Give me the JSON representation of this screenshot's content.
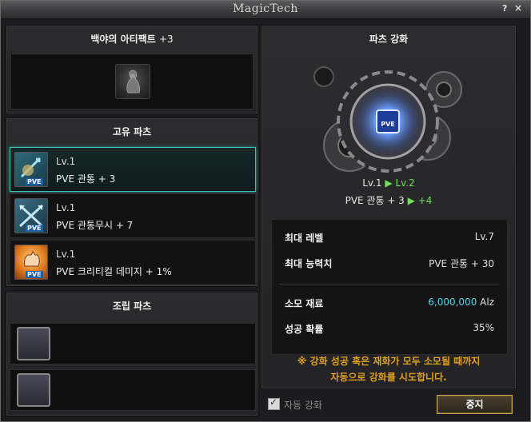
{
  "window": {
    "title": "MagicTech",
    "help_label": "?",
    "close_label": "×"
  },
  "artifact_panel": {
    "title": "백야의 아티팩트",
    "title_suffix": "+3"
  },
  "unique_parts": {
    "title": "고유 파츠",
    "items": [
      {
        "level": "Lv.1",
        "stat": "PVE 관통  +  3",
        "icon": "pve-piercing-icon",
        "badge": "PVE"
      },
      {
        "level": "Lv.1",
        "stat": "PVE 관통무시  +  7",
        "icon": "pve-piercing-ignore-icon",
        "badge": "PVE"
      },
      {
        "level": "Lv.1",
        "stat": "PVE 크리티컬 데미지  +  1%",
        "icon": "pve-critical-damage-icon",
        "badge": "PVE"
      }
    ]
  },
  "assembly_parts": {
    "title": "조립 파츠"
  },
  "enhance_panel": {
    "title": "파츠 강화",
    "level_from": "Lv.1",
    "level_to": "Lv.2",
    "stat_label": "PVE 관통  +  3",
    "stat_increase": "+4",
    "arrow": "▶",
    "info": {
      "max_level_label": "최대 레벨",
      "max_level_value": "Lv.7",
      "max_ability_label": "최대 능력치",
      "max_ability_value": "PVE 관통  + 30",
      "material_label": "소모 재료",
      "material_value": "6,000,000",
      "material_unit": "Alz",
      "success_label": "성공 확률",
      "success_value": "35%"
    },
    "notice_line1": "※ 강화 성공 혹은 재화가 모두 소모될 때까지",
    "notice_line2": "자동으로 강화를 시도합니다."
  },
  "footer": {
    "auto_enhance_label": "자동 강화",
    "auto_enhance_checked": true,
    "stop_label": "중지"
  },
  "colors": {
    "accent_cyan": "#4fd3e6",
    "accent_green": "#6fe05a",
    "notice_orange": "#e0a11c",
    "selected_border": "#3fbfb6"
  }
}
